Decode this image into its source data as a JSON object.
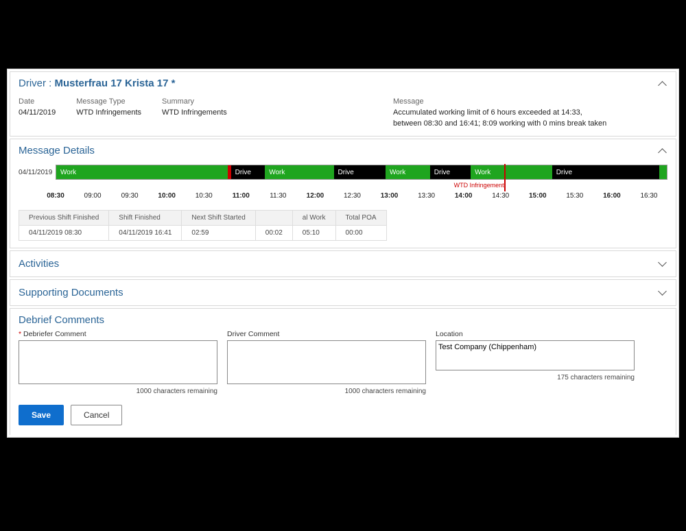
{
  "driver": {
    "label": "Driver :",
    "name": "Musterfrau 17 Krista 17 *"
  },
  "summaryFields": {
    "date": {
      "label": "Date",
      "value": "04/11/2019"
    },
    "messageType": {
      "label": "Message Type",
      "value": "WTD Infringements"
    },
    "summary": {
      "label": "Summary",
      "value": "WTD Infringements"
    },
    "message": {
      "label": "Message",
      "line1": "Accumulated working limit of 6 hours exceeded at 14:33,",
      "line2": "between 08:30 and 16:41; 8:09 working with 0 mins break taken"
    }
  },
  "sections": {
    "messageDetails": "Message Details",
    "activities": "Activities",
    "supportingDocuments": "Supporting Documents",
    "debriefComments": "Debrief Comments"
  },
  "timeline": {
    "rowDate": "04/11/2019",
    "startHour": 8.5,
    "endHour": 16.75,
    "segments": [
      {
        "type": "work",
        "label": "Work",
        "start": 8.5,
        "end": 10.82
      },
      {
        "type": "break",
        "label": "",
        "start": 10.82,
        "end": 10.86
      },
      {
        "type": "drive",
        "label": "Drive",
        "start": 10.86,
        "end": 11.32
      },
      {
        "type": "work",
        "label": "Work",
        "start": 11.32,
        "end": 12.25
      },
      {
        "type": "drive",
        "label": "Drive",
        "start": 12.25,
        "end": 12.95
      },
      {
        "type": "work",
        "label": "Work",
        "start": 12.95,
        "end": 13.55
      },
      {
        "type": "drive",
        "label": "Drive",
        "start": 13.55,
        "end": 14.1
      },
      {
        "type": "work",
        "label": "Work",
        "start": 14.1,
        "end": 15.2
      },
      {
        "type": "drive",
        "label": "Drive",
        "start": 15.2,
        "end": 16.65
      },
      {
        "type": "end",
        "label": "",
        "start": 16.65,
        "end": 16.75
      }
    ],
    "infringement": {
      "hour": 14.55,
      "label": "WTD Infringement"
    },
    "ticks": [
      {
        "h": 8.5,
        "label": "08:30",
        "major": true
      },
      {
        "h": 9.0,
        "label": "09:00",
        "major": false
      },
      {
        "h": 9.5,
        "label": "09:30",
        "major": false
      },
      {
        "h": 10.0,
        "label": "10:00",
        "major": true
      },
      {
        "h": 10.5,
        "label": "10:30",
        "major": false
      },
      {
        "h": 11.0,
        "label": "11:00",
        "major": true
      },
      {
        "h": 11.5,
        "label": "11:30",
        "major": false
      },
      {
        "h": 12.0,
        "label": "12:00",
        "major": true
      },
      {
        "h": 12.5,
        "label": "12:30",
        "major": false
      },
      {
        "h": 13.0,
        "label": "13:00",
        "major": true
      },
      {
        "h": 13.5,
        "label": "13:30",
        "major": false
      },
      {
        "h": 14.0,
        "label": "14:00",
        "major": true
      },
      {
        "h": 14.5,
        "label": "14:30",
        "major": false
      },
      {
        "h": 15.0,
        "label": "15:00",
        "major": true
      },
      {
        "h": 15.5,
        "label": "15:30",
        "major": false
      },
      {
        "h": 16.0,
        "label": "16:00",
        "major": true
      },
      {
        "h": 16.5,
        "label": "16:30",
        "major": false
      }
    ]
  },
  "shiftTable": {
    "headers": {
      "prevShiftFinished": "Previous Shift Finished",
      "shiftFinished": "Shift Finished",
      "nextShiftStarted": "Next Shift Started",
      "colA": "",
      "alWork": "al Work",
      "totalPOA": "Total POA"
    },
    "row": {
      "prevShiftFinished": "04/11/2019 08:30",
      "shiftFinished": "04/11/2019 16:41",
      "nextShiftStarted": "02:59",
      "colA": "00:02",
      "alWork": "05:10",
      "totalPOA": "00:00"
    }
  },
  "comments": {
    "debriefer": {
      "label": "Debriefer Comment",
      "value": "",
      "remaining": "1000 characters remaining"
    },
    "driver": {
      "label": "Driver Comment",
      "value": "",
      "remaining": "1000 characters remaining"
    },
    "location": {
      "label": "Location",
      "value": "Test Company (Chippenham)",
      "remaining": "175 characters remaining"
    }
  },
  "buttons": {
    "save": "Save",
    "cancel": "Cancel"
  }
}
